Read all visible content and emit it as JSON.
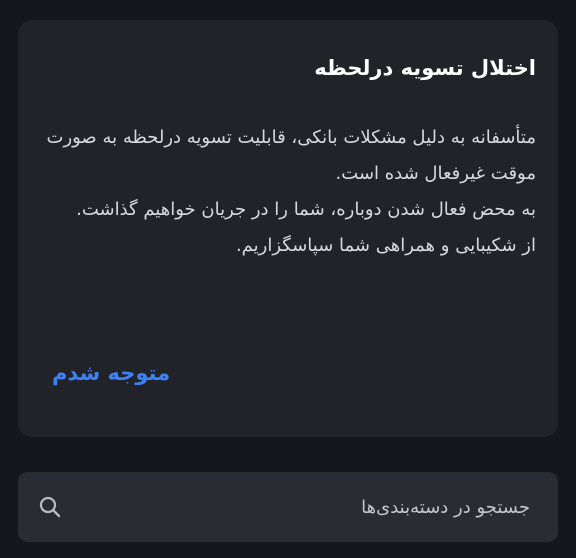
{
  "dialog": {
    "title": "اختلال تسویه درلحظه",
    "body_lines": [
      "متأسفانه به دلیل مشکلات بانکی، قابلیت تسویه درلحظه به صورت موقت غیرفعال شده است.",
      "به محض فعال شدن دوباره، شما را در جریان خواهیم گذاشت.",
      "از شکیبایی و همراهی شما سپاسگزاریم."
    ],
    "ack_label": "متوجه شدم"
  },
  "search": {
    "placeholder": "جستجو در دسته‌بندی‌ها",
    "value": "",
    "icon": "search-icon"
  },
  "colors": {
    "background": "#15171c",
    "card": "#212329",
    "search_bar": "#2a2c33",
    "accent": "#3d82f5",
    "title_text": "#ffffff",
    "body_text": "#d8d9de"
  }
}
